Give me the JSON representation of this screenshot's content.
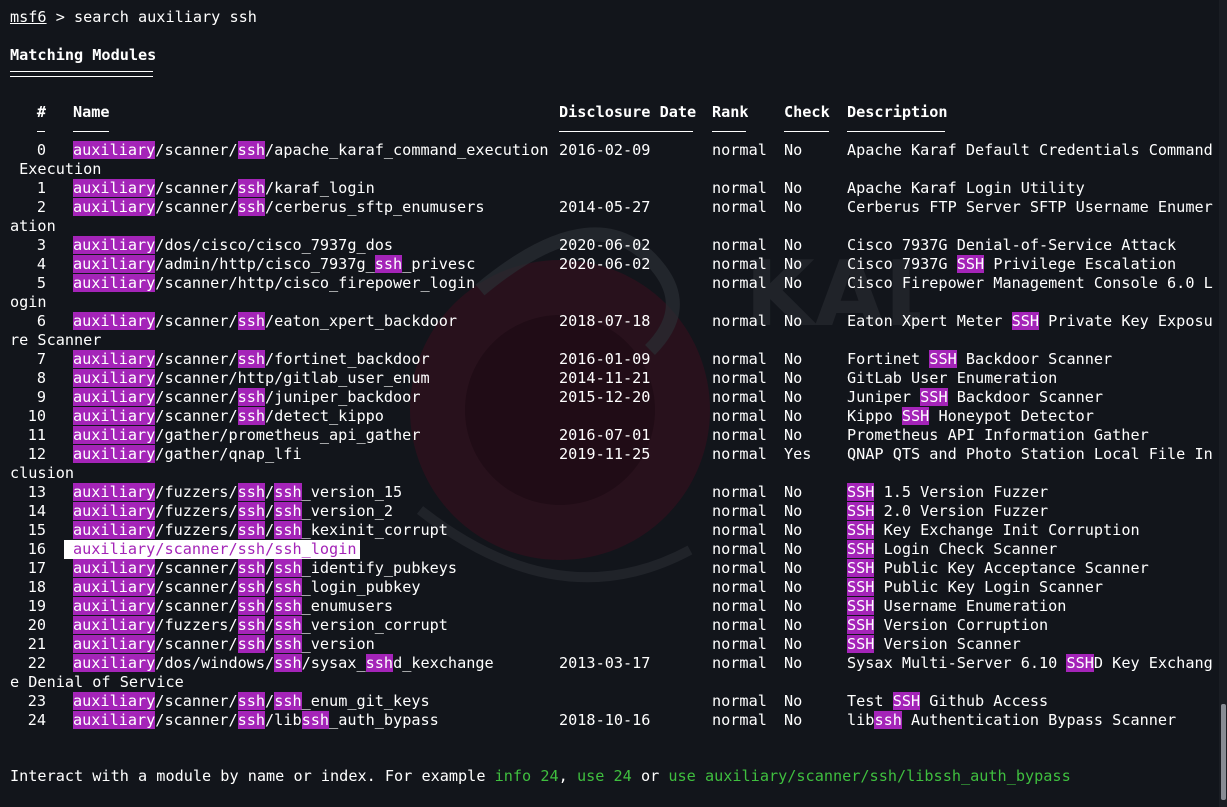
{
  "prompt": {
    "name": "msf6",
    "rest": " > search auxiliary ssh"
  },
  "heading": "Matching Modules",
  "columns": {
    "num": "#",
    "name": "Name",
    "date": "Disclosure Date",
    "rank": "Rank",
    "check": "Check",
    "desc": "Description"
  },
  "rows": [
    {
      "num": "0",
      "name": [
        "auxiliary",
        "/scanner/",
        "ssh",
        "/apache_karaf_command_execution"
      ],
      "date": "2016-02-09",
      "rank": "normal",
      "check": "No",
      "desc": [
        "Apache Karaf Default Credentials Command"
      ],
      "wrap": " Execution"
    },
    {
      "num": "1",
      "name": [
        "auxiliary",
        "/scanner/",
        "ssh",
        "/karaf_login"
      ],
      "date": "",
      "rank": "normal",
      "check": "No",
      "desc": [
        "Apache Karaf Login Utility"
      ]
    },
    {
      "num": "2",
      "name": [
        "auxiliary",
        "/scanner/",
        "ssh",
        "/cerberus_sftp_enumusers"
      ],
      "date": "2014-05-27",
      "rank": "normal",
      "check": "No",
      "desc": [
        "Cerberus FTP Server SFTP Username Enumer"
      ],
      "wrap": "ation"
    },
    {
      "num": "3",
      "name": [
        "auxiliary",
        "/dos/cisco/cisco_7937g_dos"
      ],
      "date": "2020-06-02",
      "rank": "normal",
      "check": "No",
      "desc": [
        "Cisco 7937G Denial-of-Service Attack"
      ]
    },
    {
      "num": "4",
      "name": [
        "auxiliary",
        "/admin/http/cisco_7937g_",
        "ssh",
        "_privesc"
      ],
      "date": "2020-06-02",
      "rank": "normal",
      "check": "No",
      "desc": [
        "Cisco 7937G ",
        "SSH",
        " Privilege Escalation"
      ]
    },
    {
      "num": "5",
      "name": [
        "auxiliary",
        "/scanner/http/cisco_firepower_login"
      ],
      "date": "",
      "rank": "normal",
      "check": "No",
      "desc": [
        "Cisco Firepower Management Console 6.0 L"
      ],
      "wrap": "ogin"
    },
    {
      "num": "6",
      "name": [
        "auxiliary",
        "/scanner/",
        "ssh",
        "/eaton_xpert_backdoor"
      ],
      "date": "2018-07-18",
      "rank": "normal",
      "check": "No",
      "desc": [
        "Eaton Xpert Meter ",
        "SSH",
        " Private Key Exposu"
      ],
      "wrap": "re Scanner"
    },
    {
      "num": "7",
      "name": [
        "auxiliary",
        "/scanner/",
        "ssh",
        "/fortinet_backdoor"
      ],
      "date": "2016-01-09",
      "rank": "normal",
      "check": "No",
      "desc": [
        "Fortinet ",
        "SSH",
        " Backdoor Scanner"
      ]
    },
    {
      "num": "8",
      "name": [
        "auxiliary",
        "/scanner/http/gitlab_user_enum"
      ],
      "date": "2014-11-21",
      "rank": "normal",
      "check": "No",
      "desc": [
        "GitLab User Enumeration"
      ]
    },
    {
      "num": "9",
      "name": [
        "auxiliary",
        "/scanner/",
        "ssh",
        "/juniper_backdoor"
      ],
      "date": "2015-12-20",
      "rank": "normal",
      "check": "No",
      "desc": [
        "Juniper ",
        "SSH",
        " Backdoor Scanner"
      ]
    },
    {
      "num": "10",
      "name": [
        "auxiliary",
        "/scanner/",
        "ssh",
        "/detect_kippo"
      ],
      "date": "",
      "rank": "normal",
      "check": "No",
      "desc": [
        "Kippo ",
        "SSH",
        " Honeypot Detector"
      ]
    },
    {
      "num": "11",
      "name": [
        "auxiliary",
        "/gather/prometheus_api_gather"
      ],
      "date": "2016-07-01",
      "rank": "normal",
      "check": "No",
      "desc": [
        "Prometheus API Information Gather"
      ]
    },
    {
      "num": "12",
      "name": [
        "auxiliary",
        "/gather/qnap_lfi"
      ],
      "date": "2019-11-25",
      "rank": "normal",
      "check": "Yes",
      "desc": [
        "QNAP QTS and Photo Station Local File In"
      ],
      "wrap": "clusion"
    },
    {
      "num": "13",
      "name": [
        "auxiliary",
        "/fuzzers/",
        "ssh",
        "/",
        "ssh",
        "_version_15"
      ],
      "date": "",
      "rank": "normal",
      "check": "No",
      "desc": [
        "",
        "SSH",
        " 1.5 Version Fuzzer"
      ]
    },
    {
      "num": "14",
      "name": [
        "auxiliary",
        "/fuzzers/",
        "ssh",
        "/",
        "ssh",
        "_version_2"
      ],
      "date": "",
      "rank": "normal",
      "check": "No",
      "desc": [
        "",
        "SSH",
        " 2.0 Version Fuzzer"
      ]
    },
    {
      "num": "15",
      "name": [
        "auxiliary",
        "/fuzzers/",
        "ssh",
        "/",
        "ssh",
        "_kexinit_corrupt"
      ],
      "date": "",
      "rank": "normal",
      "check": "No",
      "desc": [
        "",
        "SSH",
        " Key Exchange Init Corruption"
      ]
    },
    {
      "num": "16",
      "name": [
        "auxiliary",
        "/scanner/",
        "ssh",
        "/",
        "ssh",
        "_login"
      ],
      "date": "",
      "rank": "normal",
      "check": "No",
      "desc": [
        "",
        "SSH",
        " Login Check Scanner"
      ],
      "selected": true
    },
    {
      "num": "17",
      "name": [
        "auxiliary",
        "/scanner/",
        "ssh",
        "/",
        "ssh",
        "_identify_pubkeys"
      ],
      "date": "",
      "rank": "normal",
      "check": "No",
      "desc": [
        "",
        "SSH",
        " Public Key Acceptance Scanner"
      ]
    },
    {
      "num": "18",
      "name": [
        "auxiliary",
        "/scanner/",
        "ssh",
        "/",
        "ssh",
        "_login_pubkey"
      ],
      "date": "",
      "rank": "normal",
      "check": "No",
      "desc": [
        "",
        "SSH",
        " Public Key Login Scanner"
      ]
    },
    {
      "num": "19",
      "name": [
        "auxiliary",
        "/scanner/",
        "ssh",
        "/",
        "ssh",
        "_enumusers"
      ],
      "date": "",
      "rank": "normal",
      "check": "No",
      "desc": [
        "",
        "SSH",
        " Username Enumeration"
      ]
    },
    {
      "num": "20",
      "name": [
        "auxiliary",
        "/fuzzers/",
        "ssh",
        "/",
        "ssh",
        "_version_corrupt"
      ],
      "date": "",
      "rank": "normal",
      "check": "No",
      "desc": [
        "",
        "SSH",
        " Version Corruption"
      ]
    },
    {
      "num": "21",
      "name": [
        "auxiliary",
        "/scanner/",
        "ssh",
        "/",
        "ssh",
        "_version"
      ],
      "date": "",
      "rank": "normal",
      "check": "No",
      "desc": [
        "",
        "SSH",
        " Version Scanner"
      ]
    },
    {
      "num": "22",
      "name": [
        "auxiliary",
        "/dos/windows/",
        "ssh",
        "/sysax_",
        "ssh",
        "d_kexchange"
      ],
      "date": "2013-03-17",
      "rank": "normal",
      "check": "No",
      "desc": [
        "Sysax Multi-Server 6.10 ",
        "SSH",
        "D Key Exchang"
      ],
      "wrap": "e Denial of Service"
    },
    {
      "num": "23",
      "name": [
        "auxiliary",
        "/scanner/",
        "ssh",
        "/",
        "ssh",
        "_enum_git_keys"
      ],
      "date": "",
      "rank": "normal",
      "check": "No",
      "desc": [
        "Test ",
        "SSH",
        " Github Access"
      ]
    },
    {
      "num": "24",
      "name": [
        "auxiliary",
        "/scanner/",
        "ssh",
        "/lib",
        "ssh",
        "_auth_bypass"
      ],
      "date": "2018-10-16",
      "rank": "normal",
      "check": "No",
      "desc": [
        "lib",
        "ssh",
        " Authentication Bypass Scanner"
      ]
    }
  ],
  "footer": {
    "text1": "Interact with a module by name or index. For example ",
    "cmd1": "info 24",
    "sep1": ", ",
    "cmd2": "use 24",
    "sep2": " or ",
    "cmd3": "use auxiliary/scanner/ssh/libssh_auth_bypass"
  },
  "colors": {
    "background": "#12151b",
    "highlight": "#a424b8",
    "green": "#3fbf3f",
    "text": "#ffffff"
  },
  "icons": {
    "background_logo": "kali-dragon-logo"
  }
}
